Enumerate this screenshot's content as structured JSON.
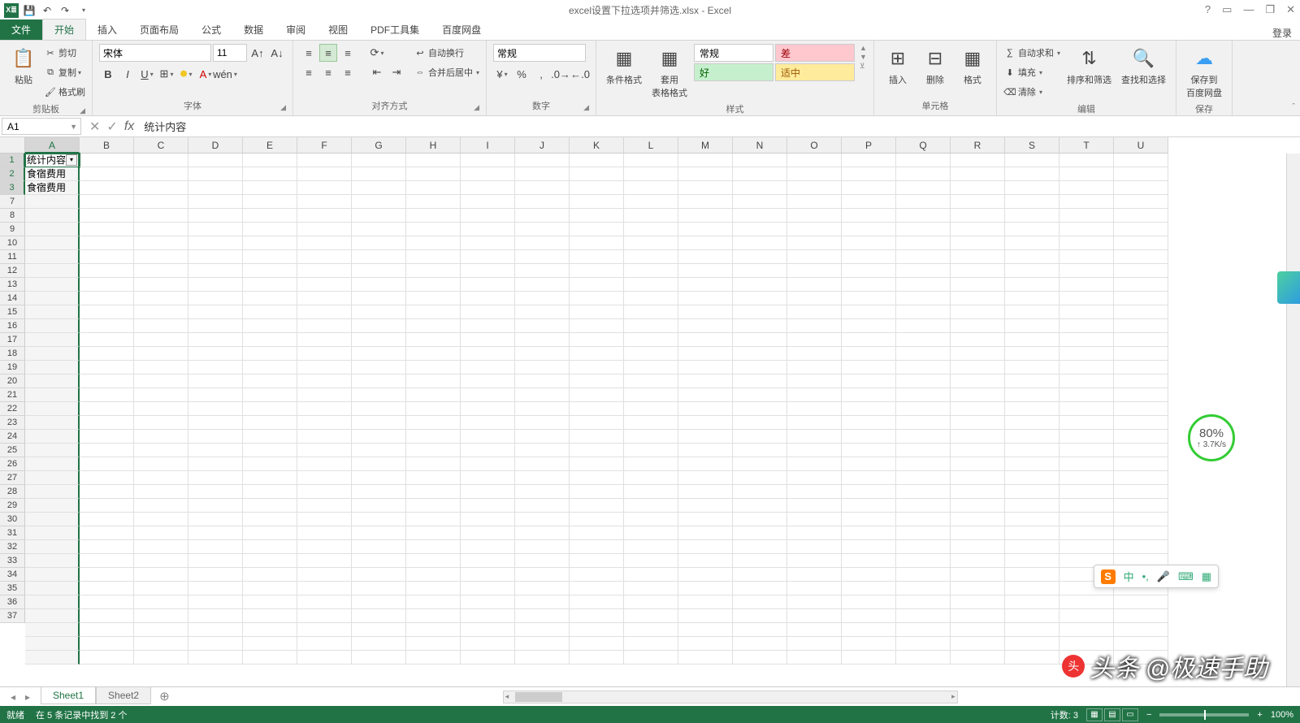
{
  "title": "excel设置下拉选项并筛选.xlsx - Excel",
  "qat": {
    "save": "💾",
    "undo": "↶",
    "redo": "↷"
  },
  "win": {
    "help": "?",
    "opts": "▭",
    "min": "—",
    "restore": "❐",
    "close": "✕"
  },
  "tabs": {
    "file": "文件",
    "home": "开始",
    "insert": "插入",
    "layout": "页面布局",
    "formulas": "公式",
    "data": "数据",
    "review": "审阅",
    "view": "视图",
    "pdf": "PDF工具集",
    "baidu": "百度网盘",
    "login": "登录"
  },
  "ribbon": {
    "clipboard": {
      "paste": "粘贴",
      "cut": "剪切",
      "copy": "复制",
      "format_painter": "格式刷",
      "label": "剪贴板"
    },
    "font": {
      "name": "宋体",
      "size": "11",
      "label": "字体"
    },
    "align": {
      "wrap": "自动换行",
      "merge": "合并后居中",
      "label": "对齐方式"
    },
    "number": {
      "format": "常规",
      "label": "数字"
    },
    "styles": {
      "cond": "条件格式",
      "table": "套用\n表格格式",
      "normal": "常规",
      "bad": "差",
      "good": "好",
      "neutral": "适中",
      "label": "样式"
    },
    "cells": {
      "insert": "插入",
      "delete": "删除",
      "format": "格式",
      "label": "单元格"
    },
    "editing": {
      "sum": "自动求和",
      "fill": "填充",
      "clear": "清除",
      "sort": "排序和筛选",
      "find": "查找和选择",
      "label": "编辑"
    },
    "save": {
      "btn": "保存到\n百度网盘",
      "label": "保存"
    }
  },
  "namebox": "A1",
  "formula": "统计内容",
  "columns": [
    "A",
    "B",
    "C",
    "D",
    "E",
    "F",
    "G",
    "H",
    "I",
    "J",
    "K",
    "L",
    "M",
    "N",
    "O",
    "P",
    "Q",
    "R",
    "S",
    "T",
    "U"
  ],
  "rows": [
    1,
    2,
    3,
    7,
    8,
    9,
    10,
    11,
    12,
    13,
    14,
    15,
    16,
    17,
    18,
    19,
    20,
    21,
    22,
    23,
    24,
    25,
    26,
    27,
    28,
    29,
    30,
    31,
    32,
    33,
    34,
    35,
    36,
    37
  ],
  "cells": {
    "A1": "统计内容",
    "A2": "食宿费用",
    "A3": "食宿费用"
  },
  "sheets": {
    "s1": "Sheet1",
    "s2": "Sheet2"
  },
  "status": {
    "ready": "就绪",
    "filter": "在 5 条记录中找到 2 个",
    "count": "计数: 3",
    "zoom": "100%"
  },
  "ime": {
    "lang": "中"
  },
  "speed": {
    "pct": "80%",
    "rate": "↑ 3.7K/s"
  },
  "watermark": "头条 @极速手助"
}
